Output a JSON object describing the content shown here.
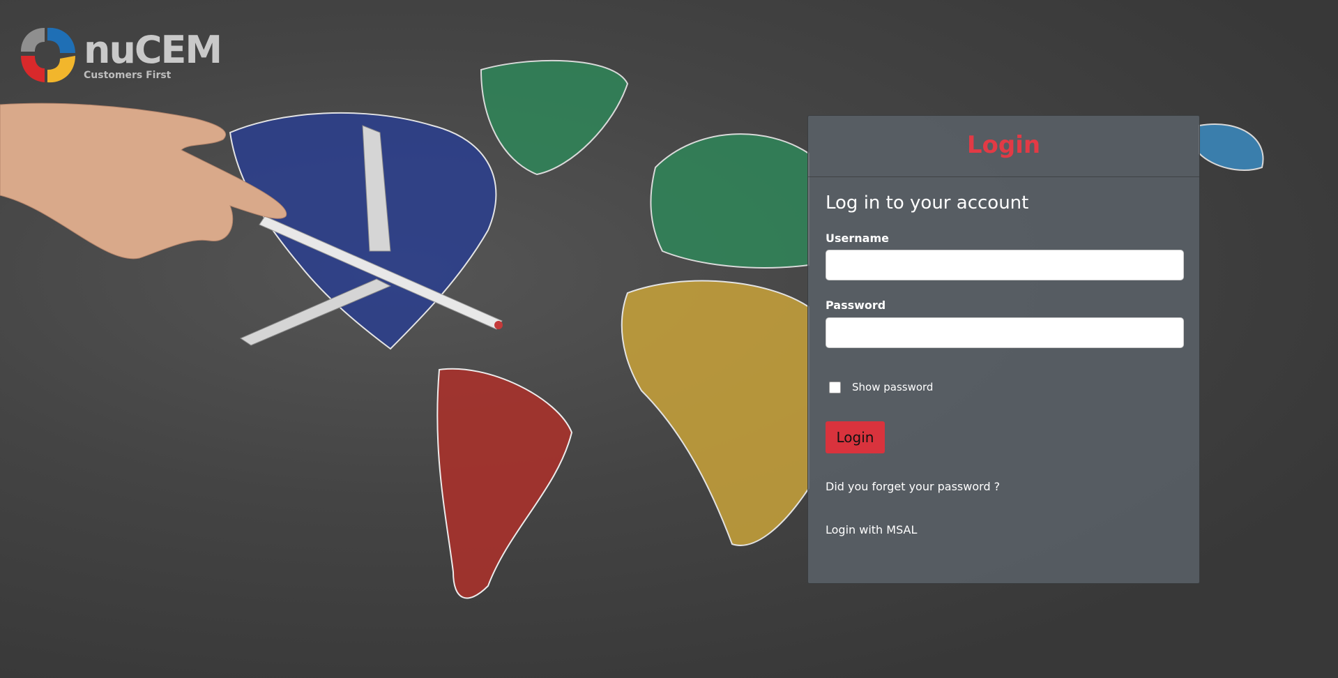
{
  "logo": {
    "name": "nuCEM",
    "tagline": "Customers First"
  },
  "login": {
    "title": "Login",
    "subtitle": "Log in to your account",
    "username_label": "Username",
    "username_value": "",
    "password_label": "Password",
    "password_value": "",
    "show_password_label": "Show password",
    "show_password_checked": false,
    "submit_label": "Login",
    "forgot_link": "Did you forget your password ?",
    "msal_link": "Login with MSAL"
  },
  "colors": {
    "accent": "#e23a45",
    "button": "#d9333d",
    "panel": "#5a6268"
  }
}
